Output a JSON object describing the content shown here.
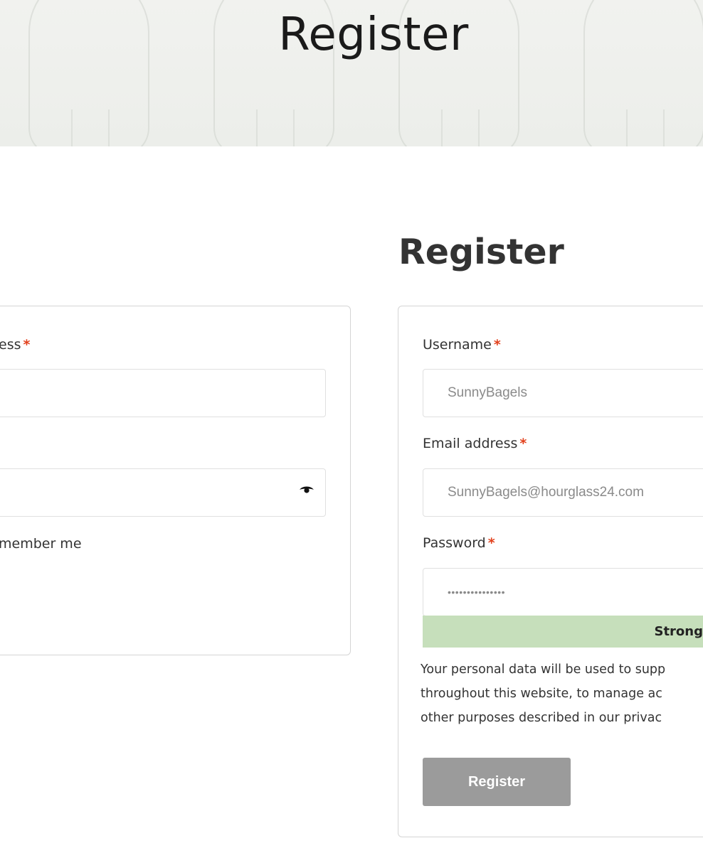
{
  "hero": {
    "title": "Register"
  },
  "register_section": {
    "title": "Register"
  },
  "login_form": {
    "email_label_partial": "ess",
    "required_mark": "*",
    "remember_label_partial": "member me",
    "password_toggle_icon": "eye-icon"
  },
  "register_form": {
    "username_label": "Username",
    "username_value": "SunnyBagels",
    "email_label": "Email address",
    "email_value": "SunnyBagels@hourglass24.com",
    "password_label": "Password",
    "password_value": "•••••••••••••••",
    "required_mark": "*",
    "strength_label": "Strong",
    "strength_color": "#c6dfbb",
    "privacy_lines": [
      "Your personal data will be used to supp",
      "throughout this website, to manage ac",
      "other purposes described in our privac"
    ],
    "submit_label": "Register",
    "submit_color": "#9b9b9b",
    "required_color": "#e2401c"
  }
}
